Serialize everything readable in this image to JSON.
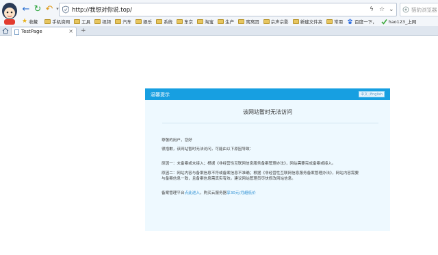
{
  "browser": {
    "address": {
      "url": "http://我想对你说.top/",
      "lightning_icon": "lightning-icon",
      "star_icon": "star-outline-icon",
      "dropdown_icon": "chevron-down-icon"
    },
    "search": {
      "placeholder": "猎豹浏览器"
    },
    "bookmarks": [
      {
        "label": "收藏",
        "icon": "star-icon"
      },
      {
        "label": "手机资网",
        "icon": "folder-icon"
      },
      {
        "label": "工具",
        "icon": "folder-icon"
      },
      {
        "label": "视频",
        "icon": "folder-icon"
      },
      {
        "label": "汽车",
        "icon": "folder-icon"
      },
      {
        "label": "娱乐",
        "icon": "folder-icon"
      },
      {
        "label": "系统",
        "icon": "folder-icon"
      },
      {
        "label": "东京",
        "icon": "folder-icon"
      },
      {
        "label": "淘宝",
        "icon": "folder-icon"
      },
      {
        "label": "生产",
        "icon": "folder-icon"
      },
      {
        "label": "窝窝团",
        "icon": "folder-icon"
      },
      {
        "label": "佘声佘影",
        "icon": "folder-icon"
      },
      {
        "label": "新建文件夹",
        "icon": "folder-icon"
      },
      {
        "label": "常用",
        "icon": "folder-icon"
      },
      {
        "label": "百度一下，",
        "icon": "paw-icon"
      },
      {
        "label": "hao123_上网",
        "icon": "hao123-icon"
      }
    ],
    "tabs": [
      {
        "label": "TestPage",
        "close": "×"
      }
    ],
    "new_tab": "+"
  },
  "page": {
    "header_title": "温馨提示",
    "lang": {
      "zh": "中文",
      "en": "English"
    },
    "headline": "该网站暂时无法访问",
    "greeting": "尊敬的用户，您好",
    "intro": "很抱歉，该网站暂时无法访问，可能由以下原因导致：",
    "reason1": "原因一：未备案或未接入；根据《非经营性互联网信息服务备案管理办法》，网站需要完成备案或接入。",
    "reason2_line1": "原因二：网站内容与备案信息不符或备案信息不准确；根据《非经营性互联网信息服务备案管理办法》，网站内容需要",
    "reason2_line2": "与备案信息一致，且备案信息需真实有效。建议网站管理员尽快修改网站信息。",
    "footer_prefix": "备案管理平台",
    "footer_link1": "点此进入",
    "footer_mid": "，购买云服务器",
    "footer_link2": "享30元/月超低价"
  },
  "colors": {
    "header_blue": "#179fe1",
    "panel_bg": "#eef9ff",
    "link": "#2b8fd3"
  }
}
